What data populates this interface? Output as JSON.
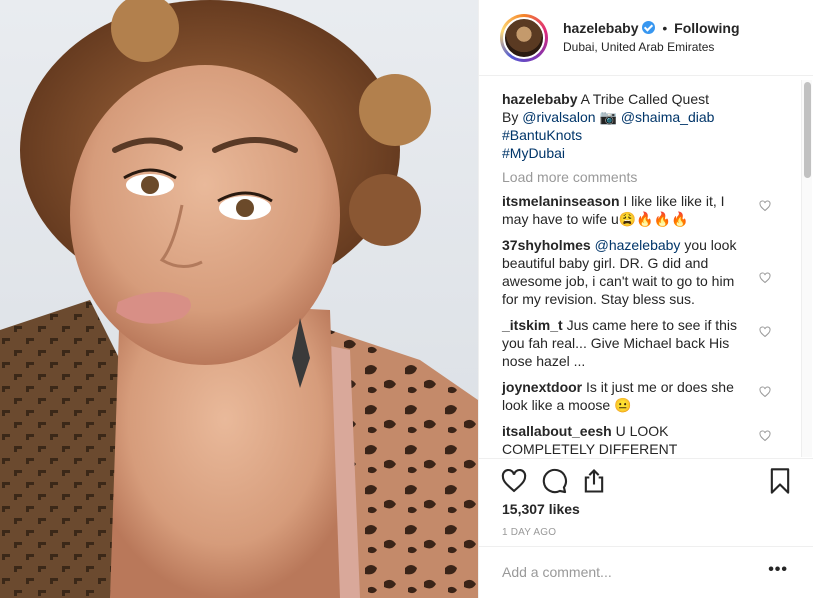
{
  "post": {
    "username": "hazelebaby",
    "follow_status": "Following",
    "separator": "•",
    "location": "Dubai, United Arab Emirates",
    "image_alt": "Portrait photo"
  },
  "caption": {
    "username": "hazelebaby",
    "title": "A Tribe Called Quest",
    "by_prefix": "By",
    "mention1": "@rivalsalon",
    "camera_emoji": "📷",
    "mention2": "@shaima_diab",
    "hashtag1": "#BantuKnots",
    "hashtag2": "#MyDubai"
  },
  "load_more": "Load more comments",
  "comments": [
    {
      "username": "itsmelaninseason",
      "text": " I like like like it, I may have to wife u😩🔥🔥🔥"
    },
    {
      "username": "37shyholmes",
      "mention": "@hazelebaby",
      "text": " you look beautiful baby girl. DR. G did and awesome job, i can't wait to go to him for my revision. Stay bless sus."
    },
    {
      "username": "_itskim_t",
      "text": " Jus came here to see if this you fah real... Give Michael back His nose hazel ..."
    },
    {
      "username": "joynextdoor",
      "text": " Is it just me or does she look like a moose 😐"
    },
    {
      "username": "itsallabout_eesh",
      "text": " U LOOK COMPLETELY DIFFERENT"
    }
  ],
  "likes": "15,307 likes",
  "time": "1 DAY AGO",
  "add_comment_placeholder": "Add a comment...",
  "more_label": "•••",
  "colors": {
    "link": "#003569",
    "verified": "#3897f0",
    "muted": "#999999",
    "text": "#262626"
  },
  "icons": [
    "heart-icon",
    "comment-icon",
    "share-icon",
    "bookmark-icon",
    "verified-badge-icon"
  ]
}
